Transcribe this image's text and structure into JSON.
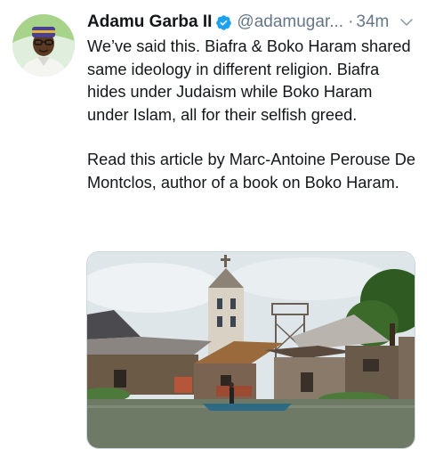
{
  "tweet": {
    "author": {
      "name": "Adamu Garba II",
      "handle": "@adamugar...",
      "verified": true
    },
    "separator": "·",
    "time": "34m",
    "paragraphs": [
      "We’ve said this. Biafra & Boko Haram shared same ideology in different religion. Biafra hides under Judaism while Boko Haram under Islam, all for their selfish greed.",
      "Read this article by Marc-Antoine Perouse De Montclos, author of a book on Boko Haram."
    ],
    "media": {
      "subject": "church-tower-over-riverside-shanty-town"
    }
  },
  "colors": {
    "text": "#14171a",
    "secondary": "#657786",
    "verified": "#1da1f2",
    "border": "#ccd6dd"
  },
  "icons": {
    "verified": "verified-badge-icon",
    "menu": "chevron-down-icon"
  }
}
